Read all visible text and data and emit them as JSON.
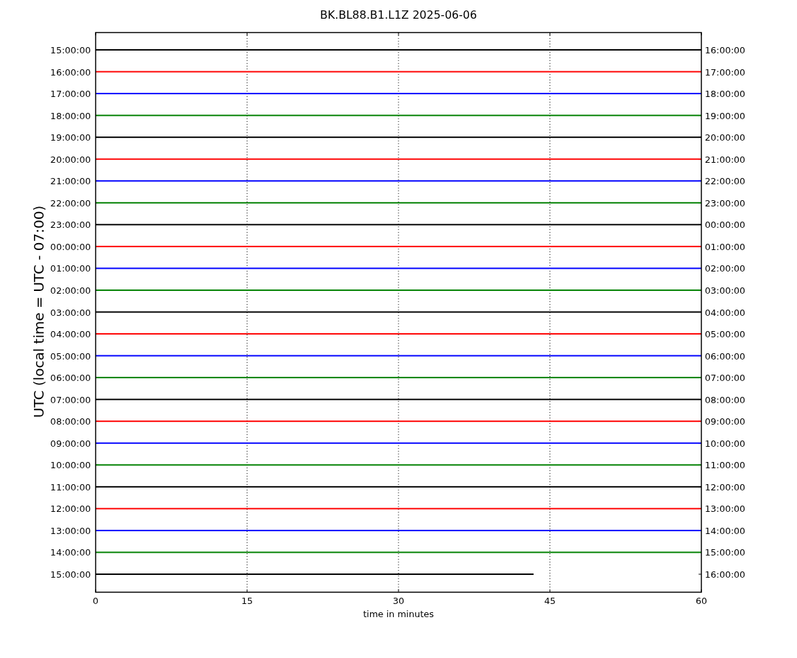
{
  "title": "BK.BL88.B1.L1Z 2025-06-06",
  "ylabel": "UTC (local time = UTC - 07:00)",
  "xlabel": "time in minutes",
  "xticks": [
    "0",
    "15",
    "30",
    "45",
    "60"
  ],
  "rows": [
    {
      "left": "15:00:00",
      "right": "16:00:00",
      "color": "#000000",
      "level": 1
    },
    {
      "left": "16:00:00",
      "right": "17:00:00",
      "color": "#ff0000",
      "level": 1
    },
    {
      "left": "17:00:00",
      "right": "18:00:00",
      "color": "#0000ff",
      "level": 1
    },
    {
      "left": "18:00:00",
      "right": "19:00:00",
      "color": "#008000",
      "level": 1
    },
    {
      "left": "19:00:00",
      "right": "20:00:00",
      "color": "#000000",
      "level": 1
    },
    {
      "left": "20:00:00",
      "right": "21:00:00",
      "color": "#ff0000",
      "level": 1
    },
    {
      "left": "21:00:00",
      "right": "22:00:00",
      "color": "#0000ff",
      "level": 1
    },
    {
      "left": "22:00:00",
      "right": "23:00:00",
      "color": "#008000",
      "level": 1
    },
    {
      "left": "23:00:00",
      "right": "00:00:00",
      "color": "#000000",
      "level": 1
    },
    {
      "left": "00:00:00",
      "right": "01:00:00",
      "color": "#ff0000",
      "level": 1
    },
    {
      "left": "01:00:00",
      "right": "02:00:00",
      "color": "#0000ff",
      "level": 1
    },
    {
      "left": "02:00:00",
      "right": "03:00:00",
      "color": "#008000",
      "level": 1
    },
    {
      "left": "03:00:00",
      "right": "04:00:00",
      "color": "#000000",
      "level": 1
    },
    {
      "left": "04:00:00",
      "right": "05:00:00",
      "color": "#ff0000",
      "level": 1
    },
    {
      "left": "05:00:00",
      "right": "06:00:00",
      "color": "#0000ff",
      "level": 1
    },
    {
      "left": "06:00:00",
      "right": "07:00:00",
      "color": "#008000",
      "level": 1
    },
    {
      "left": "07:00:00",
      "right": "08:00:00",
      "color": "#000000",
      "level": 1
    },
    {
      "left": "08:00:00",
      "right": "09:00:00",
      "color": "#ff0000",
      "level": 1
    },
    {
      "left": "09:00:00",
      "right": "10:00:00",
      "color": "#0000ff",
      "level": 1
    },
    {
      "left": "10:00:00",
      "right": "11:00:00",
      "color": "#008000",
      "level": 1
    },
    {
      "left": "11:00:00",
      "right": "12:00:00",
      "color": "#000000",
      "level": 1
    },
    {
      "left": "12:00:00",
      "right": "13:00:00",
      "color": "#ff0000",
      "level": 1
    },
    {
      "left": "13:00:00",
      "right": "14:00:00",
      "color": "#0000ff",
      "level": 1
    },
    {
      "left": "14:00:00",
      "right": "15:00:00",
      "color": "#008000",
      "level": 1
    },
    {
      "left": "15:00:00",
      "right": "16:00:00",
      "color": "#000000",
      "level": 0.723
    }
  ]
}
